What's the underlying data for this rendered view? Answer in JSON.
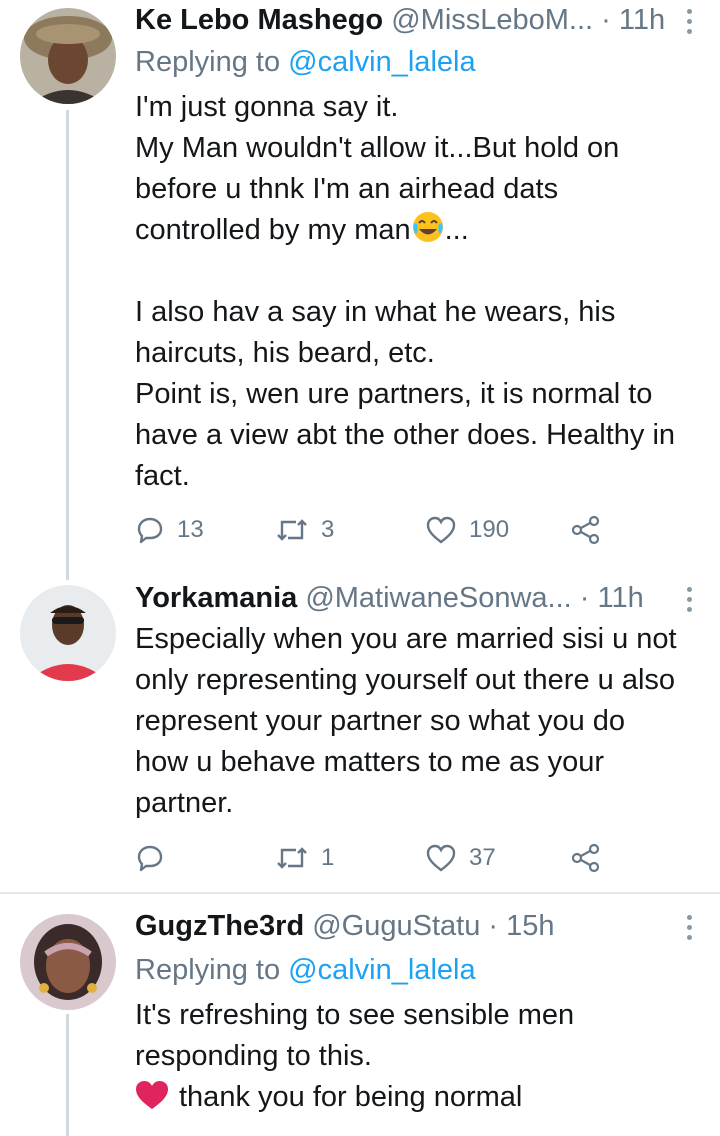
{
  "tweets": [
    {
      "name": "Ke Lebo Mashego",
      "handle": "@MissLeboM...",
      "separator": "·",
      "time": "11h",
      "replying_label": "Replying to",
      "replying_to": "@calvin_lalela",
      "lines": [
        "I'm just gonna say it.",
        "My Man wouldn't allow it...But hold on",
        "before u thnk I'm an airhead dats",
        "controlled by my man",
        "...",
        "I also hav a say in what he wears, his",
        "haircuts, his beard, etc.",
        "Point is, wen ure partners, it is normal to",
        "have a view abt the other does. Healthy in",
        "fact."
      ],
      "replies": "13",
      "retweets": "3",
      "likes": "190"
    },
    {
      "name": "Yorkamania",
      "handle": "@MatiwaneSonwa...",
      "separator": "·",
      "time": "11h",
      "lines": [
        "Especially when you are married sisi u not",
        "only representing yourself out there u also",
        "represent your partner so what you do",
        "how u behave matters to me as your",
        "partner."
      ],
      "retweets": "1",
      "likes": "37"
    },
    {
      "name": "GugzThe3rd",
      "handle": "@GuguStatu",
      "separator": "·",
      "time": "15h",
      "replying_label": "Replying to",
      "replying_to": "@calvin_lalela",
      "lines": [
        "It's refreshing to see sensible men",
        "responding to this.",
        "thank you for being normal"
      ]
    }
  ],
  "colors": {
    "link": "#1da1f2",
    "secondary_text": "#657786",
    "divider": "#e1e8ed",
    "heart_emoji": "#e0245e"
  },
  "icons": [
    "reply-icon",
    "retweet-icon",
    "like-icon",
    "share-icon",
    "more-options-icon",
    "face-with-tears-of-joy-emoji",
    "red-heart-emoji"
  ]
}
